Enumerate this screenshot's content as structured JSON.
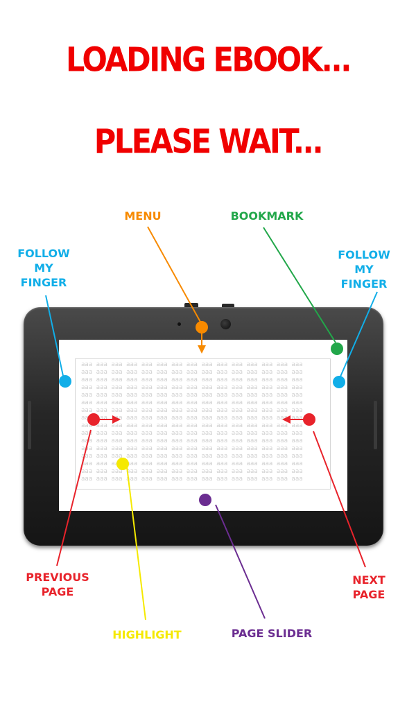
{
  "header": {
    "line1": "LOADING EBOOK...",
    "line2": "PLEASE WAIT..."
  },
  "labels": {
    "menu": "MENU",
    "bookmark": "BOOKMARK",
    "follow_left": "FOLLOW\nMY\nFINGER",
    "follow_right": "FOLLOW\nMY\nFINGER",
    "previous_page": "PREVIOUS\nPAGE",
    "next_page": "NEXT\nPAGE",
    "highlight": "HIGHLIGHT",
    "page_slider": "PAGE SLIDER"
  },
  "placeholder_text": {
    "word": "aaa",
    "words_per_line": 15,
    "lines": 16
  },
  "colors": {
    "title": "#f00000",
    "menu": "#f78a00",
    "bookmark": "#22a74a",
    "follow": "#11aee8",
    "page_turn": "#e8232b",
    "highlight": "#f5e900",
    "page_slider": "#6b2d91"
  }
}
